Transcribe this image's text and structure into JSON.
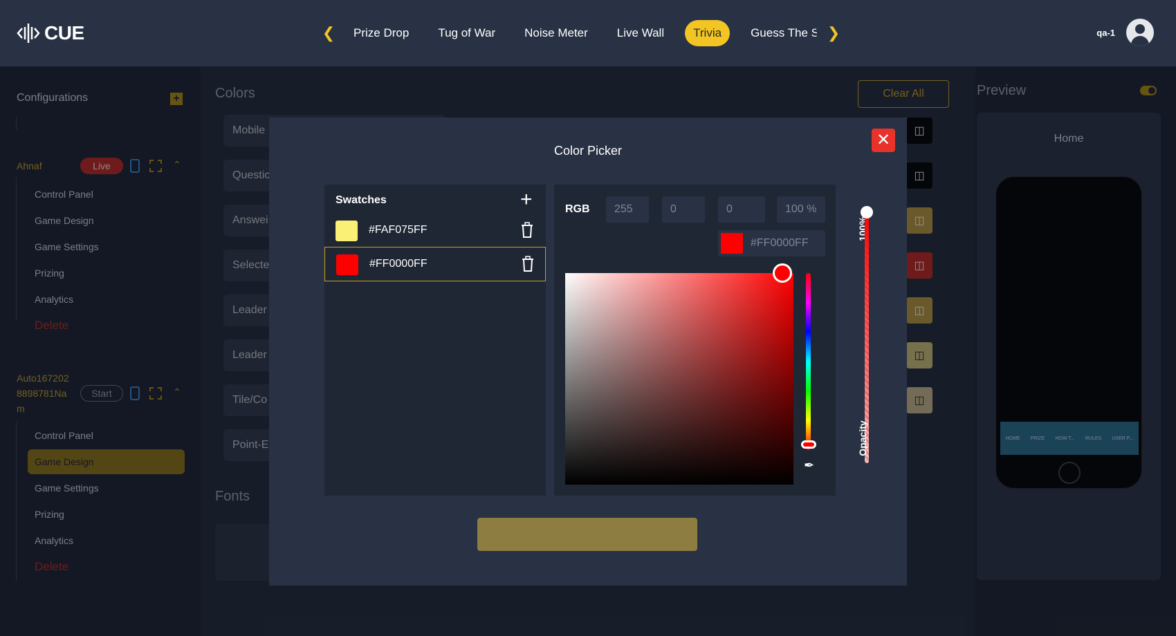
{
  "app": {
    "logo_text": "CUE"
  },
  "nav": {
    "items": [
      "Prize Drop",
      "Tug of War",
      "Noise Meter",
      "Live Wall",
      "Trivia",
      "Guess The Sc"
    ],
    "active": "Trivia",
    "prev_icon": "chevron-left-icon",
    "next_icon": "chevron-right-icon"
  },
  "user": {
    "name": "qa-1"
  },
  "sidebar": {
    "title": "Configurations",
    "configs": [
      {
        "name": "Ahnaf",
        "status": "Live",
        "items": [
          "Control Panel",
          "Game Design",
          "Game Settings",
          "Prizing",
          "Analytics"
        ],
        "delete_label": "Delete"
      },
      {
        "name_lines": [
          "Auto167202",
          "8898781Na",
          "m"
        ],
        "status": "Start",
        "items": [
          "Control Panel",
          "Game Design",
          "Game Settings",
          "Prizing",
          "Analytics"
        ],
        "active_item": "Game Design",
        "delete_label": "Delete"
      }
    ]
  },
  "main": {
    "colors_title": "Colors",
    "clear_all": "Clear All",
    "rows": [
      "Mobile",
      "Questic",
      "Answei",
      "Selecte",
      "Leader",
      "Leader",
      "Tile/Co",
      "Point-E"
    ],
    "fonts_title": "Fonts"
  },
  "preview": {
    "title": "Preview",
    "screen": "Home",
    "phone_tabs": [
      "HOME",
      "PRIZE",
      "HOW T...",
      "RULES",
      "USER P..."
    ]
  },
  "color_picker": {
    "title": "Color Picker",
    "swatches_title": "Swatches",
    "swatches": [
      {
        "hex": "#FAF075FF",
        "color": "#FAF075"
      },
      {
        "hex": "#FF0000FF",
        "color": "#FF0000"
      }
    ],
    "selected_swatch": "#FF0000FF",
    "mode": "RGB",
    "r": "255",
    "g": "0",
    "b": "0",
    "alpha": "100 %",
    "hex_value": "#FF0000FF",
    "opacity_value": "100%",
    "opacity_label": "Opacity",
    "save_label": "."
  },
  "colors": {
    "accent": "#F2C522",
    "danger": "#E8332B",
    "surface": "#283244"
  }
}
